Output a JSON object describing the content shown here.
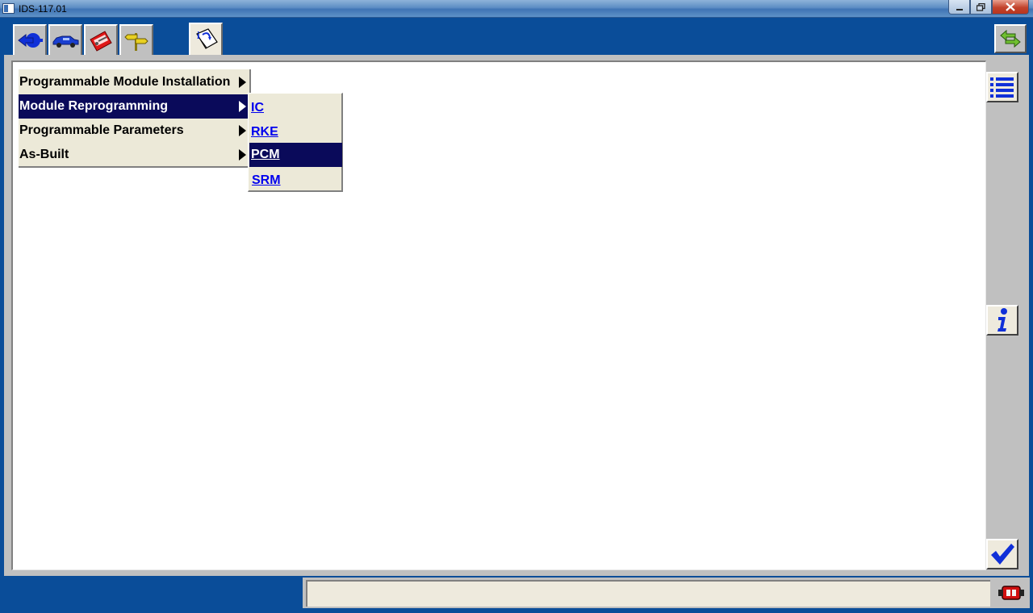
{
  "window": {
    "title": "IDS-117.01",
    "controls": [
      "minimize",
      "restore",
      "close"
    ]
  },
  "toolbar": {
    "buttons": [
      {
        "name": "session-icon",
        "active": false
      },
      {
        "name": "vehicle-icon",
        "active": false
      },
      {
        "name": "toolbox-icon",
        "active": false
      },
      {
        "name": "signpost-icon",
        "active": false
      },
      {
        "name": "module-programming-icon",
        "active": true
      }
    ],
    "right_button": "swap-arrows-icon"
  },
  "menu": {
    "items": [
      {
        "label": "Programmable Module Installation",
        "selected": false,
        "has_submenu": true
      },
      {
        "label": "Module Reprogramming",
        "selected": true,
        "has_submenu": true
      },
      {
        "label": "Programmable Parameters",
        "selected": false,
        "has_submenu": true
      },
      {
        "label": "As-Built",
        "selected": false,
        "has_submenu": true
      }
    ],
    "submenu": [
      {
        "label": "IC",
        "selected": false
      },
      {
        "label": "RKE",
        "selected": false
      },
      {
        "label": "PCM",
        "selected": true
      },
      {
        "label": "SRM",
        "selected": false
      }
    ]
  },
  "sidebar": {
    "buttons": [
      "list-icon",
      "info-icon",
      "checkmark-icon"
    ]
  },
  "status": {
    "text": "",
    "icon": "vcm-connection-icon"
  },
  "colors": {
    "frame_blue": "#0a4d99",
    "selection": "#0a0a5a",
    "link": "#0000ee",
    "menu_bg": "#ece9d8"
  }
}
